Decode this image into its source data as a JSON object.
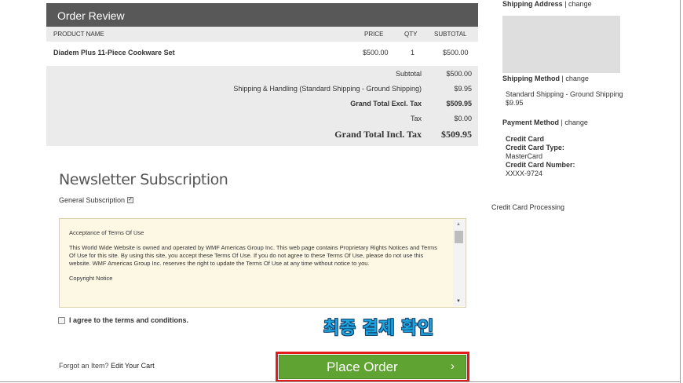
{
  "order_review": {
    "title": "Order Review",
    "columns": {
      "product": "PRODUCT NAME",
      "price": "PRICE",
      "qty": "QTY",
      "subtotal": "SUBTOTAL"
    },
    "items": [
      {
        "name": "Diadem Plus 11-Piece Cookware Set",
        "price": "$500.00",
        "qty": "1",
        "subtotal": "$500.00"
      }
    ],
    "totals": {
      "subtotal_label": "Subtotal",
      "subtotal_value": "$500.00",
      "shipping_label": "Shipping & Handling (Standard Shipping - Ground Shipping)",
      "shipping_value": "$9.95",
      "grand_excl_label": "Grand Total Excl. Tax",
      "grand_excl_value": "$509.95",
      "tax_label": "Tax",
      "tax_value": "$0.00",
      "grand_incl_label": "Grand Total Incl. Tax",
      "grand_incl_value": "$509.95"
    }
  },
  "newsletter": {
    "title": "Newsletter Subscription",
    "general_label": "General Subscription"
  },
  "terms": {
    "heading": "Acceptance of Terms Of Use",
    "body": "This World Wide Website is owned and operated by WMF Americas Group Inc. This web page contains Proprietary Rights Notices and Terms Of Use for this site. By using this site, you accept these Terms Of Use. If you do not agree to these Terms Of Use, please do not use this website. WMF Americas Group Inc. reserves the right to update the Terms Of Use at any time without notice to you.",
    "next_heading": "Copyright Notice",
    "agree_label": "I agree to the terms and conditions."
  },
  "annotation": "최종 결제 확인",
  "footer": {
    "forgot_text": "Forgot an Item?",
    "edit_cart": "Edit Your Cart",
    "place_order": "Place Order",
    "place_order_arrow": "›"
  },
  "sidebar": {
    "shipping_address": "Shipping Address",
    "shipping_method": "Shipping Method",
    "change": "change",
    "separator": "|",
    "shipping_method_name": "Standard Shipping - Ground Shipping",
    "shipping_method_price": "$9.95",
    "payment_method": "Payment Method",
    "card_type_heading": "Credit Card",
    "card_type_label": "Credit Card Type:",
    "card_type_value": "MasterCard",
    "card_number_label": "Credit Card Number:",
    "card_number_value": "XXXX-9724",
    "processing": "Credit Card Processing"
  },
  "colors": {
    "header_bg": "#585858",
    "place_order_green": "#5fa332",
    "highlight_red": "#e31b1b",
    "annotation_blue": "#1da5e0"
  }
}
